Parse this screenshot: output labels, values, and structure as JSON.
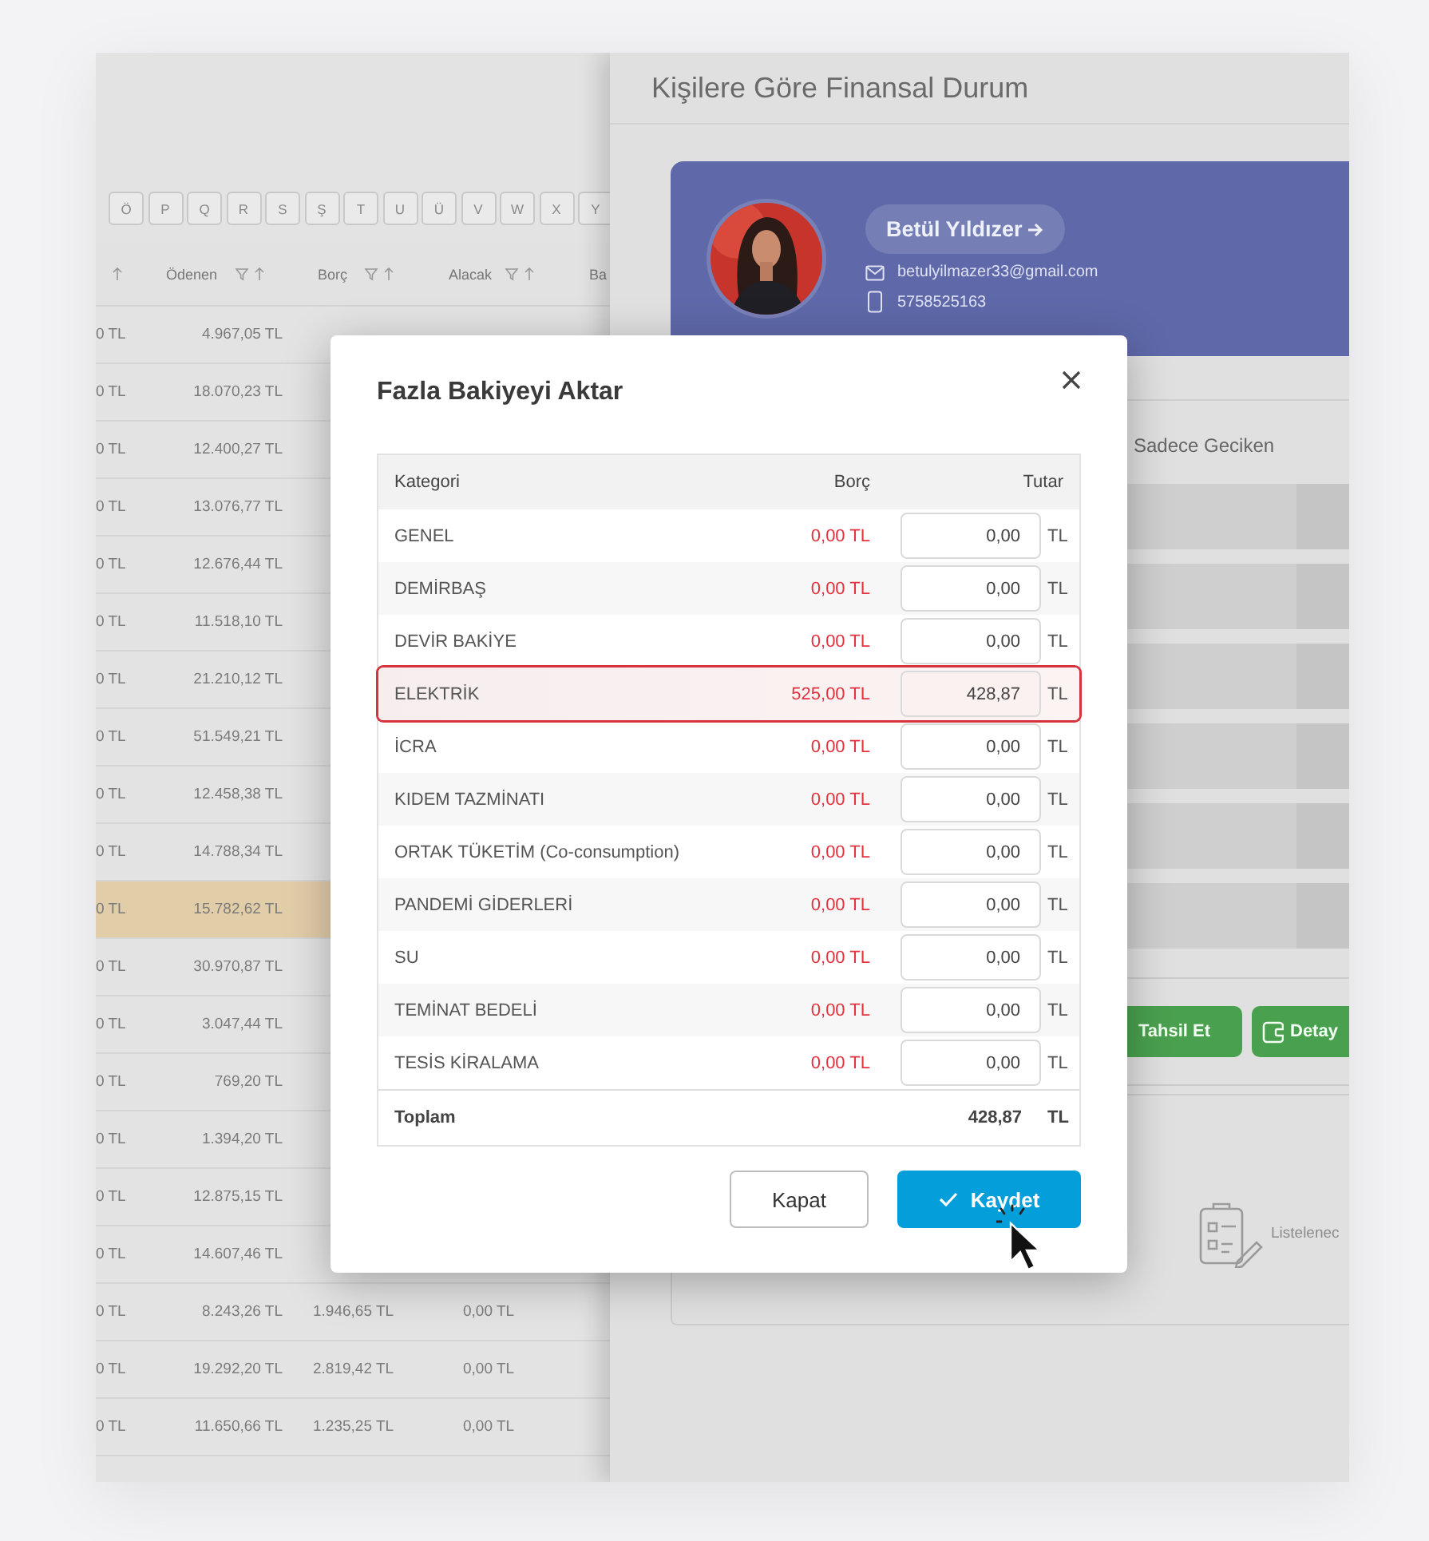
{
  "letter_bar": [
    "Ö",
    "P",
    "Q",
    "R",
    "S",
    "Ş",
    "T",
    "U",
    "Ü",
    "V",
    "W",
    "X",
    "Y"
  ],
  "payments_table": {
    "columns": [
      "Ödenen",
      "Borç",
      "Alacak",
      "Ba"
    ],
    "rows": [
      {
        "column_1": "0 TL",
        "paid": "4.967,05 TL",
        "selected": false
      },
      {
        "column_1": "0 TL",
        "paid": "18.070,23 TL",
        "selected": false
      },
      {
        "column_1": "0 TL",
        "paid": "12.400,27 TL",
        "selected": false
      },
      {
        "column_1": "0 TL",
        "paid": "13.076,77 TL",
        "selected": false
      },
      {
        "column_1": "0 TL",
        "paid": "12.676,44 TL",
        "selected": false
      },
      {
        "column_1": "0 TL",
        "paid": "11.518,10 TL",
        "selected": false
      },
      {
        "column_1": "0 TL",
        "paid": "21.210,12 TL",
        "selected": false
      },
      {
        "column_1": "0 TL",
        "paid": "51.549,21 TL",
        "selected": false
      },
      {
        "column_1": "0 TL",
        "paid": "12.458,38 TL",
        "selected": false
      },
      {
        "column_1": "0 TL",
        "paid": "14.788,34 TL",
        "selected": false
      },
      {
        "column_1": "0 TL",
        "paid": "15.782,62 TL",
        "selected": true
      },
      {
        "column_1": "0 TL",
        "paid": "30.970,87 TL",
        "selected": false
      },
      {
        "column_1": "0 TL",
        "paid": "3.047,44 TL",
        "selected": false
      },
      {
        "column_1": "0 TL",
        "paid": "769,20 TL",
        "selected": false
      },
      {
        "column_1": "0 TL",
        "paid": "1.394,20 TL",
        "selected": false
      },
      {
        "column_1": "0 TL",
        "paid": "12.875,15 TL",
        "selected": false
      },
      {
        "column_1": "0 TL",
        "paid": "14.607,46 TL",
        "selected": false
      },
      {
        "column_1": "0 TL",
        "paid": "8.243,26 TL",
        "debt": "1.946,65 TL",
        "credit": "0,00 TL",
        "selected": false
      },
      {
        "column_1": "0 TL",
        "paid": "19.292,20 TL",
        "debt": "2.819,42 TL",
        "credit": "0,00 TL",
        "selected": false
      },
      {
        "column_1": "0 TL",
        "paid": "11.650,66 TL",
        "debt": "1.235,25 TL",
        "credit": "0,00 TL",
        "selected": false
      }
    ]
  },
  "drawer": {
    "title": "Kişilere Göre Finansal Durum",
    "person": {
      "name": "Betül Yıldızer",
      "email": "betulyilmazer33@gmail.com",
      "phone": "5758525163"
    },
    "filter_label": "Sadece Geciken",
    "actions": [
      {
        "label": "Tahsil Et",
        "kind": "collect"
      },
      {
        "label": "Detay",
        "kind": "detail"
      }
    ],
    "empty_text": "Listelenec"
  },
  "dialog": {
    "title": "Fazla Bakiyeyi Aktar",
    "columns": [
      "Kategori",
      "Borç",
      "Tutar"
    ],
    "rows": [
      {
        "category": "GENEL",
        "debt": "0,00 TL",
        "amount": "0,00",
        "currency": "TL",
        "selected": false
      },
      {
        "category": "DEMİRBAŞ",
        "debt": "0,00 TL",
        "amount": "0,00",
        "currency": "TL",
        "selected": false
      },
      {
        "category": "DEVİR BAKİYE",
        "debt": "0,00 TL",
        "amount": "0,00",
        "currency": "TL",
        "selected": false
      },
      {
        "category": "ELEKTRİK",
        "debt": "525,00 TL",
        "amount": "428,87",
        "currency": "TL",
        "selected": true
      },
      {
        "category": "İCRA",
        "debt": "0,00 TL",
        "amount": "0,00",
        "currency": "TL",
        "selected": false
      },
      {
        "category": "KIDEM TAZMİNATI",
        "debt": "0,00 TL",
        "amount": "0,00",
        "currency": "TL",
        "selected": false
      },
      {
        "category": "ORTAK TÜKETİM (Co-consumption)",
        "debt": "0,00 TL",
        "amount": "0,00",
        "currency": "TL",
        "selected": false
      },
      {
        "category": "PANDEMİ GİDERLERİ",
        "debt": "0,00 TL",
        "amount": "0,00",
        "currency": "TL",
        "selected": false
      },
      {
        "category": "SU",
        "debt": "0,00 TL",
        "amount": "0,00",
        "currency": "TL",
        "selected": false
      },
      {
        "category": "TEMİNAT BEDELİ",
        "debt": "0,00 TL",
        "amount": "0,00",
        "currency": "TL",
        "selected": false
      },
      {
        "category": "TESİS KİRALAMA",
        "debt": "0,00 TL",
        "amount": "0,00",
        "currency": "TL",
        "selected": false
      }
    ],
    "total": {
      "label": "Toplam",
      "amount": "428,87",
      "currency": "TL"
    },
    "buttons": [
      {
        "label": "Kapat",
        "kind": "secondary"
      },
      {
        "label": "Kaydet",
        "kind": "primary"
      }
    ]
  }
}
